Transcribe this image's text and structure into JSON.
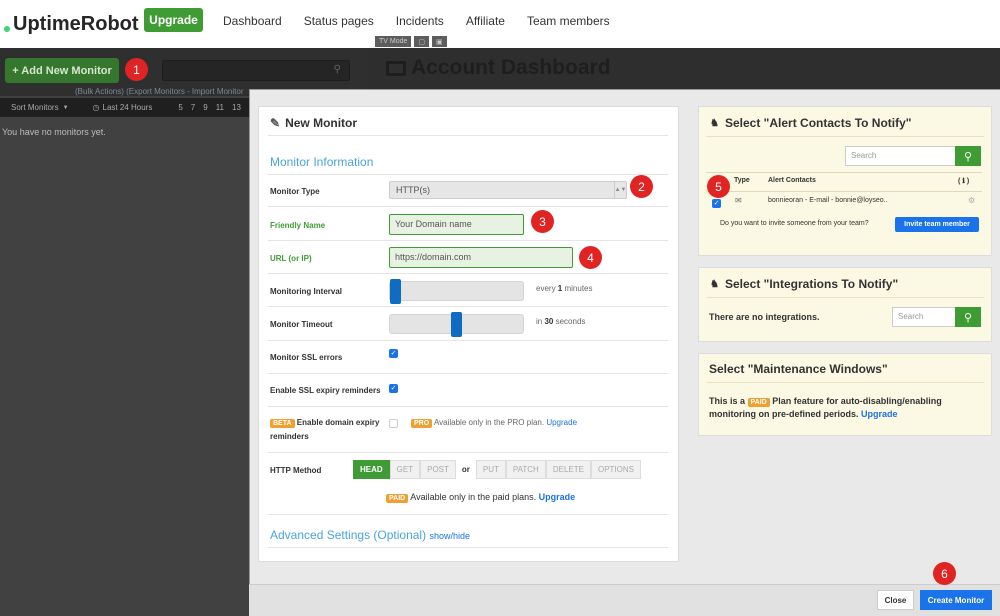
{
  "app": {
    "logo_text": "UptimeRobot",
    "upgrade_label": "Upgrade"
  },
  "nav": [
    "Dashboard",
    "Status pages",
    "Incidents",
    "Affiliate",
    "Team members"
  ],
  "sidebar": {
    "add_monitor_label": "+ Add New Monitor",
    "bulk_text": "(Bulk Actions) (Export Monitors - Import Monitor",
    "sort_label": "Sort Monitors",
    "period_label": "Last 24 Hours",
    "hours": [
      "5",
      "7",
      "9",
      "11",
      "13"
    ],
    "empty_text": "You have no monitors yet."
  },
  "main": {
    "tv_mode": "TV Mode",
    "title": "Account Dashboard"
  },
  "form": {
    "title": "New Monitor",
    "section_info": "Monitor Information",
    "monitor_type_label": "Monitor Type",
    "monitor_type_value": "HTTP(s)",
    "friendly_name_label": "Friendly Name",
    "friendly_name_placeholder": "Your Domain name",
    "url_label": "URL (or IP)",
    "url_placeholder": "https://domain.com",
    "interval_label": "Monitoring Interval",
    "interval_prefix": "every",
    "interval_value": "1",
    "interval_suffix": "minutes",
    "interval_level": 0.0,
    "timeout_label": "Monitor Timeout",
    "timeout_prefix": "in",
    "timeout_value": "30",
    "timeout_suffix": "seconds",
    "timeout_level": 0.5,
    "ssl_errors_label": "Monitor SSL errors",
    "ssl_expiry_label": "Enable SSL expiry reminders",
    "beta_badge": "BETA",
    "domain_expiry_label_1": "Enable domain expiry",
    "domain_expiry_label_2": "reminders",
    "pro_badge": "PRO",
    "pro_text": "Available only in the PRO plan.",
    "pro_link": "Upgrade",
    "http_method_label": "HTTP Method",
    "methods_left": [
      "HEAD",
      "GET",
      "POST"
    ],
    "or_text": "or",
    "methods_right": [
      "PUT",
      "PATCH",
      "DELETE",
      "OPTIONS"
    ],
    "paid_badge": "PAID",
    "paid_text": "Available only in the paid plans.",
    "paid_link": "Upgrade",
    "advanced_label": "Advanced Settings (Optional)",
    "advanced_toggle": "show/hide"
  },
  "alerts": {
    "title": "Select \"Alert Contacts To Notify\"",
    "search_placeholder": "Search",
    "col_type": "Type",
    "col_contacts": "Alert Contacts",
    "col_info": "( ℹ )",
    "contact_text": "bonnieoran - E-mail - bonnie@loyseo..",
    "invite_text": "Do you want to invite someone from your team?",
    "invite_button": "Invite team member"
  },
  "integrations": {
    "title": "Select \"Integrations To Notify\"",
    "empty_text": "There are no integrations.",
    "search_placeholder": "Search"
  },
  "maintenance": {
    "title": "Select \"Maintenance Windows\"",
    "text_1": "This is a",
    "paid_badge": "PAID",
    "text_2": "Plan feature for auto-disabling/enabling",
    "text_3": "monitoring on pre-defined periods.",
    "link": "Upgrade"
  },
  "footer": {
    "close_label": "Close",
    "create_label": "Create Monitor"
  },
  "markers": [
    "1",
    "2",
    "3",
    "4",
    "5",
    "6"
  ],
  "colors": {
    "green": "#3f9c35",
    "blue": "#1a73e8",
    "marker": "#e02424",
    "panel_yellow": "#fbf8e3"
  }
}
